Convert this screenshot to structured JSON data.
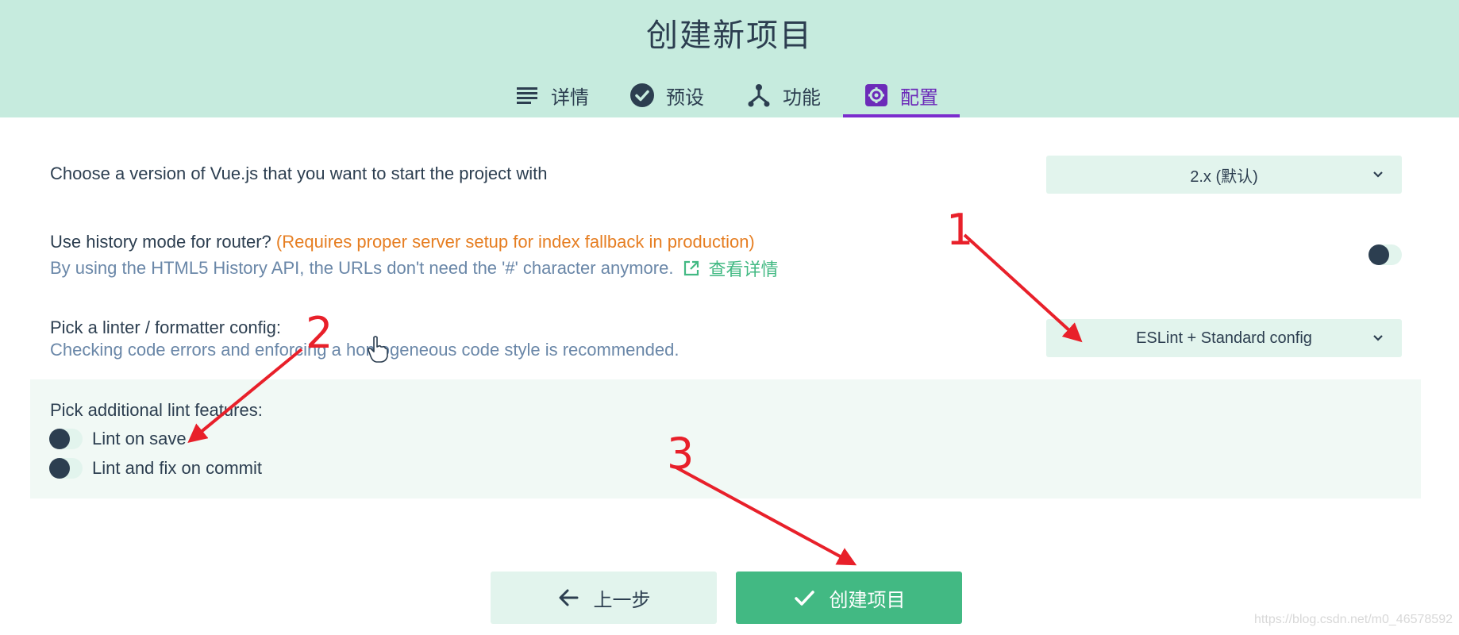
{
  "header": {
    "title": "创建新项目",
    "tabs": [
      {
        "label": "详情",
        "icon": "list-icon",
        "active": false
      },
      {
        "label": "预设",
        "icon": "check-circle-icon",
        "active": false
      },
      {
        "label": "功能",
        "icon": "feature-branch-icon",
        "active": false
      },
      {
        "label": "配置",
        "icon": "gear-icon",
        "active": true
      }
    ]
  },
  "config": {
    "vue_version": {
      "label": "Choose a version of Vue.js that you want to start the project with",
      "selected": "2.x (默认)"
    },
    "history_mode": {
      "label": "Use history mode for router?",
      "warning": "(Requires proper server setup for index fallback in production)",
      "description": "By using the HTML5 History API, the URLs don't need the '#' character anymore.",
      "more_link": "查看详情",
      "enabled": false
    },
    "linter": {
      "label": "Pick a linter / formatter config:",
      "description": "Checking code errors and enforcing a homogeneous code style is recommended.",
      "selected": "ESLint + Standard config"
    },
    "lint_features": {
      "label": "Pick additional lint features:",
      "options": [
        {
          "label": "Lint on save",
          "checked": false
        },
        {
          "label": "Lint and fix on commit",
          "checked": false
        }
      ]
    }
  },
  "footer": {
    "prev_label": "上一步",
    "create_label": "创建项目"
  },
  "annotations": {
    "marker_1": "1",
    "marker_2": "2",
    "marker_3": "3",
    "arrow_color": "#e8202a"
  },
  "watermark": "https://blog.csdn.net/m0_46578592",
  "colors": {
    "header_bg": "#c6ebde",
    "accent_green": "#42b983",
    "active_tab": "#6c2bb9",
    "text": "#2c3e50",
    "muted": "#6a87a8",
    "warning": "#e67e22"
  }
}
